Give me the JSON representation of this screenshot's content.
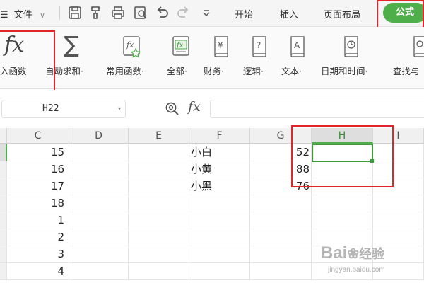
{
  "menubar": {
    "menu_glyph": "☰",
    "file_label": "文件",
    "file_caret": "∨",
    "tabs": [
      "开始",
      "插入",
      "页面布局"
    ],
    "active_tab": "公式",
    "accent_color": "#4eae4a"
  },
  "ribbon": {
    "insert_function": {
      "icon": "fx-icon",
      "glyph": "fx",
      "label": "入函数"
    },
    "autosum": {
      "icon": "sigma-icon",
      "glyph": "∑",
      "label": "自动求和·"
    },
    "common": {
      "icon": "fx-star-icon",
      "label": "常用函数·"
    },
    "all": {
      "icon": "fx-box-icon",
      "label": "全部·"
    },
    "finance": {
      "icon": "yen-book-icon",
      "glyph": "¥",
      "label": "财务·"
    },
    "logic": {
      "icon": "question-book-icon",
      "glyph": "?",
      "label": "逻辑·"
    },
    "text": {
      "icon": "a-book-icon",
      "glyph": "A",
      "label": "文本·"
    },
    "datetime": {
      "icon": "clock-book-icon",
      "label": "日期和时间·"
    },
    "lookup": {
      "icon": "lookup-book-icon",
      "label": "查找与"
    }
  },
  "formula_bar": {
    "cell_ref": "H22",
    "zoom_icon": "magnifier-icon",
    "fx_glyph": "fx",
    "value": ""
  },
  "grid": {
    "columns": [
      "C",
      "D",
      "E",
      "F",
      "G",
      "H",
      "I"
    ],
    "selected_column": "H",
    "rows": [
      {
        "c": "15",
        "f": "小白",
        "g": "52"
      },
      {
        "c": "16",
        "f": "小黄",
        "g": "88"
      },
      {
        "c": "17",
        "f": "小黑",
        "g": "76"
      },
      {
        "c": "18",
        "f": "",
        "g": ""
      },
      {
        "c": "1",
        "f": "",
        "g": ""
      },
      {
        "c": "2",
        "f": "",
        "g": ""
      },
      {
        "c": "3",
        "f": "",
        "g": ""
      },
      {
        "c": "4",
        "f": "",
        "g": ""
      }
    ]
  },
  "watermark": {
    "brand": "Bai",
    "brand_cn": "经验",
    "url": "jingyan.baidu.com"
  }
}
